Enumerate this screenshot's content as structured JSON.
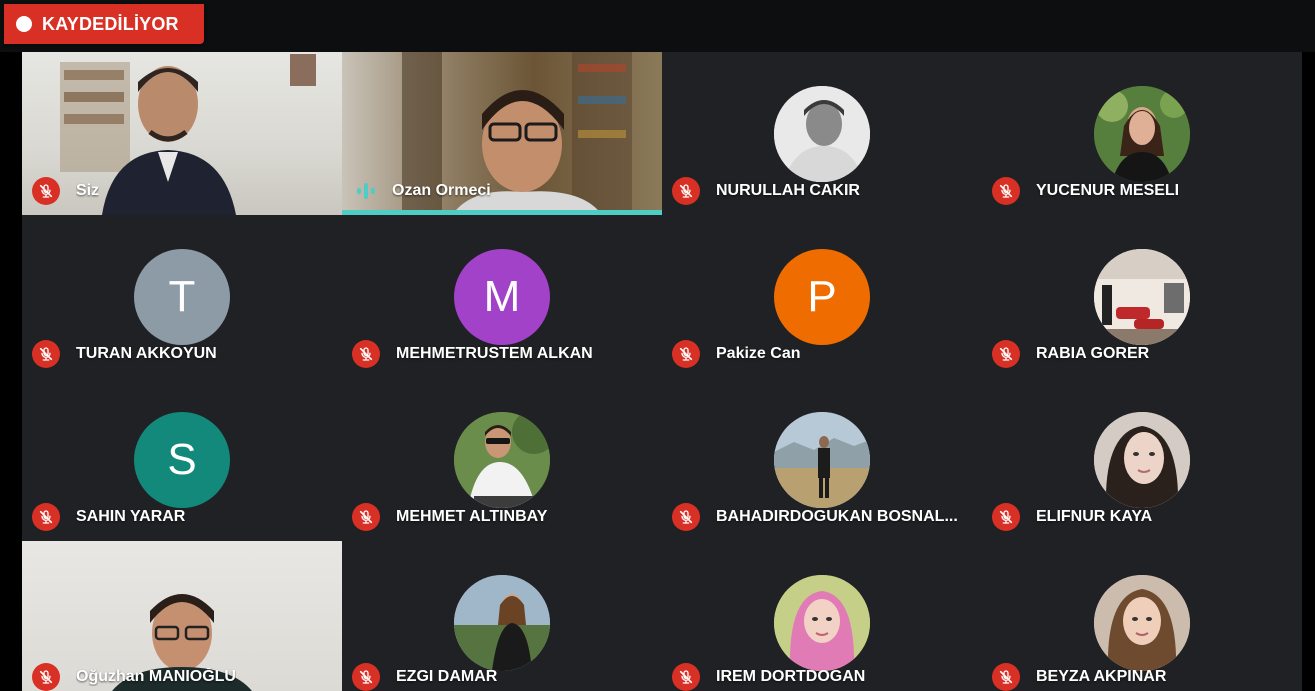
{
  "recording": {
    "label": "KAYDEDİLİYOR",
    "color": "#d93025"
  },
  "colors": {
    "background": "#202124",
    "mic_off": "#d93025",
    "speaking_accent": "#4ecdc4"
  },
  "participants": [
    {
      "name": "Siz",
      "mic": "muted",
      "media": "video",
      "icon": "mic-off-icon"
    },
    {
      "name": "Ozan Ormeci",
      "mic": "speaking",
      "media": "video",
      "icon": "audio-level-icon"
    },
    {
      "name": "NURULLAH CAKIR",
      "mic": "muted",
      "media": "photo",
      "icon": "mic-off-icon"
    },
    {
      "name": "YUCENUR MESELI",
      "mic": "muted",
      "media": "photo",
      "icon": "mic-off-icon"
    },
    {
      "name": "TURAN AKKOYUN",
      "mic": "muted",
      "media": "initial",
      "initial": "T",
      "avatar_color": "#8d9ba6",
      "icon": "mic-off-icon"
    },
    {
      "name": "MEHMETRUSTEM ALKAN",
      "mic": "muted",
      "media": "initial",
      "initial": "M",
      "avatar_color": "#a142c8",
      "icon": "mic-off-icon"
    },
    {
      "name": "Pakize Can",
      "mic": "muted",
      "media": "initial",
      "initial": "P",
      "avatar_color": "#ef6c00",
      "icon": "mic-off-icon"
    },
    {
      "name": "RABIA GORER",
      "mic": "muted",
      "media": "photo",
      "icon": "mic-off-icon"
    },
    {
      "name": "SAHIN YARAR",
      "mic": "muted",
      "media": "initial",
      "initial": "S",
      "avatar_color": "#12897b",
      "icon": "mic-off-icon"
    },
    {
      "name": "MEHMET ALTINBAY",
      "mic": "muted",
      "media": "photo",
      "icon": "mic-off-icon"
    },
    {
      "name": "BAHADIRDOGUKAN BOSNAL...",
      "mic": "muted",
      "media": "photo",
      "icon": "mic-off-icon"
    },
    {
      "name": "ELIFNUR KAYA",
      "mic": "muted",
      "media": "photo",
      "icon": "mic-off-icon"
    },
    {
      "name": "Oğuzhan MANIOĞLU",
      "mic": "muted",
      "media": "video",
      "icon": "mic-off-icon"
    },
    {
      "name": "EZGI DAMAR",
      "mic": "muted",
      "media": "photo",
      "icon": "mic-off-icon"
    },
    {
      "name": "IREM DORTDOGAN",
      "mic": "muted",
      "media": "photo",
      "icon": "mic-off-icon"
    },
    {
      "name": "BEYZA AKPINAR",
      "mic": "muted",
      "media": "photo",
      "icon": "mic-off-icon"
    }
  ]
}
